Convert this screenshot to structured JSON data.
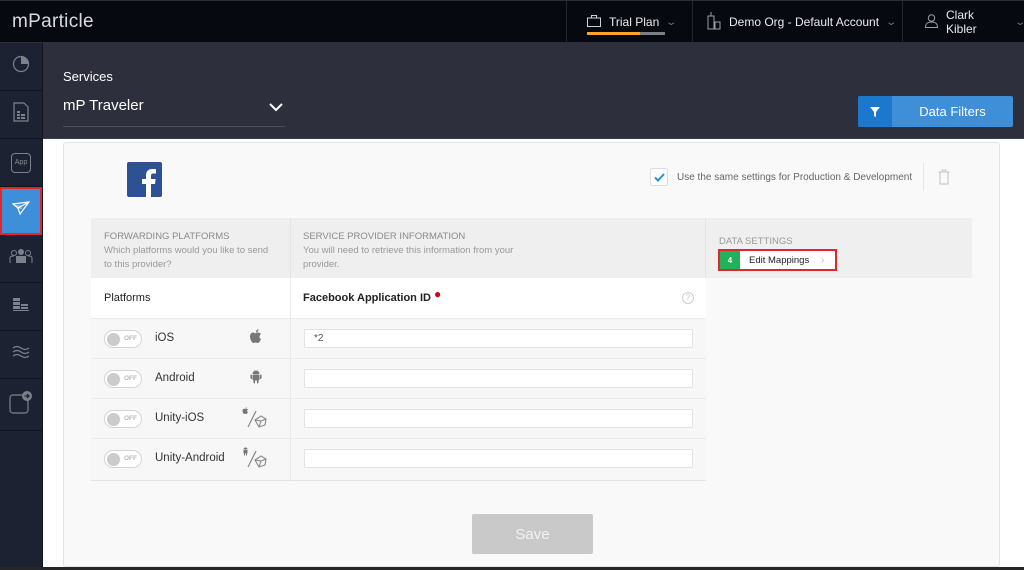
{
  "app": {
    "logo": "mParticle"
  },
  "topnav": {
    "plan": {
      "label": "Trial Plan",
      "usage_fraction": 0.68,
      "icon": "briefcase-icon",
      "accent": "#f5a623"
    },
    "org": {
      "label": "Demo Org - Default Account",
      "icon": "building-icon"
    },
    "user": {
      "label": "Clark Kibler",
      "icon": "user-icon"
    }
  },
  "sidebar": {
    "items": [
      {
        "name": "activity",
        "icon": "pie-chart-icon",
        "active": false
      },
      {
        "name": "reports",
        "icon": "document-report-icon",
        "active": false
      },
      {
        "name": "app",
        "icon": "app-icon",
        "label": "App",
        "active": false
      },
      {
        "name": "directory",
        "icon": "paper-plane-icon",
        "active": true
      },
      {
        "name": "audience",
        "icon": "users-icon",
        "active": false
      },
      {
        "name": "data-master",
        "icon": "bars-icon",
        "active": false
      },
      {
        "name": "live-stream",
        "icon": "waves-icon",
        "active": false
      },
      {
        "name": "outputs",
        "icon": "export-icon",
        "active": false
      }
    ]
  },
  "header": {
    "section_label": "Services",
    "service_select": {
      "value": "mP Traveler"
    },
    "data_filters_label": "Data Filters"
  },
  "config": {
    "provider": "Facebook",
    "same_settings": {
      "label": "Use the same settings for Production & Development",
      "checked": true
    },
    "columns": {
      "forwarding": {
        "title": "FORWARDING PLATFORMS",
        "desc": "Which platforms would you like to send to this provider?"
      },
      "provider_info": {
        "title": "SERVICE PROVIDER INFORMATION",
        "desc": "You will need to retrieve this information from your provider."
      },
      "data_settings": {
        "title": "DATA SETTINGS"
      }
    },
    "platforms_header": "Platforms",
    "field_label": "Facebook Application ID",
    "field_required": true,
    "edit_mappings": {
      "count": "4",
      "label": "Edit Mappings"
    },
    "platforms": [
      {
        "name": "iOS",
        "toggle": "OFF",
        "icon": "apple-icon",
        "app_id": "*2"
      },
      {
        "name": "Android",
        "toggle": "OFF",
        "icon": "android-icon",
        "app_id": ""
      },
      {
        "name": "Unity-iOS",
        "toggle": "OFF",
        "icon": "apple-unity-icon",
        "app_id": ""
      },
      {
        "name": "Unity-Android",
        "toggle": "OFF",
        "icon": "android-unity-icon",
        "app_id": ""
      }
    ],
    "save_label": "Save"
  }
}
